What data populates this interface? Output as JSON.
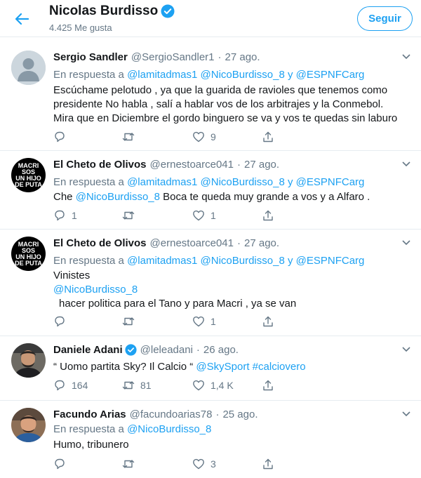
{
  "header": {
    "title": "Nicolas Burdisso",
    "likes": "4.425 Me gusta",
    "follow_label": "Seguir"
  },
  "tweets": [
    {
      "name": "Sergio Sandler",
      "handle": "@SergioSandler1",
      "sep": "·",
      "date": "27 ago.",
      "reply_prefix": "En respuesta a",
      "reply_links": "@lamitadmas1 @NicoBurdisso_8 y @ESPNFCarg",
      "lines": [
        "Escúchame pelotudo , ya que la guarida de ravioles que tenemos como",
        "presidente No habla , salí a hablar vos de los arbitrajes y la Conmebol.",
        "Mira que en Diciembre el gordo binguero se va y vos te quedas sin laburo"
      ],
      "reply_count": "",
      "retweet_count": "",
      "like_count": "9",
      "avatar": "default-avatar"
    },
    {
      "name": "El Cheto de Olivos",
      "handle": "@ernestoarce041",
      "sep": "·",
      "date": "27 ago.",
      "reply_prefix": "En respuesta a",
      "reply_links": "@lamitadmas1 @NicoBurdisso_8 y @ESPNFCarg",
      "text_prefix": "Che",
      "text_link": "@NicoBurdisso_8",
      "text_suffix": "Boca te queda muy grande a vos y a Alfaro .",
      "reply_count": "1",
      "retweet_count": "",
      "like_count": "1",
      "avatar_text": [
        "MACRI",
        "SOS",
        "UN HIJO",
        "DE PUTA"
      ]
    },
    {
      "name": "El Cheto de Olivos",
      "handle": "@ernestoarce041",
      "sep": "·",
      "date": "27 ago.",
      "reply_prefix": "En respuesta a",
      "reply_links": "@lamitadmas1 @NicoBurdisso_8 y @ESPNFCarg",
      "line1": "Vinistes",
      "line2_link": "@NicoBurdisso_8",
      "line3": "hacer politica para el Tano y para Macri , ya se van",
      "reply_count": "",
      "retweet_count": "",
      "like_count": "1",
      "avatar_text": [
        "MACRI",
        "SOS",
        "UN HIJO",
        "DE PUTA"
      ]
    },
    {
      "name": "Daniele Adani",
      "handle": "@leleadani",
      "sep": "·",
      "date": "26 ago.",
      "text_prefix": "“ Uomo partita Sky? Il Calcio “",
      "text_link1": "@SkySport",
      "text_link2": "#calciovero",
      "reply_count": "164",
      "retweet_count": "81",
      "like_count": "1,4 K"
    },
    {
      "name": "Facundo Arias",
      "handle": "@facundoarias78",
      "sep": "·",
      "date": "25 ago.",
      "reply_prefix": "En respuesta a",
      "reply_links": "@NicoBurdisso_8",
      "text": "Humo, tribunero",
      "reply_count": "",
      "retweet_count": "",
      "like_count": "3"
    }
  ],
  "colors": {
    "accent": "#1da1f2",
    "secondary_text": "#657786",
    "primary_text": "#14171a",
    "divider": "#e6ecf0"
  }
}
